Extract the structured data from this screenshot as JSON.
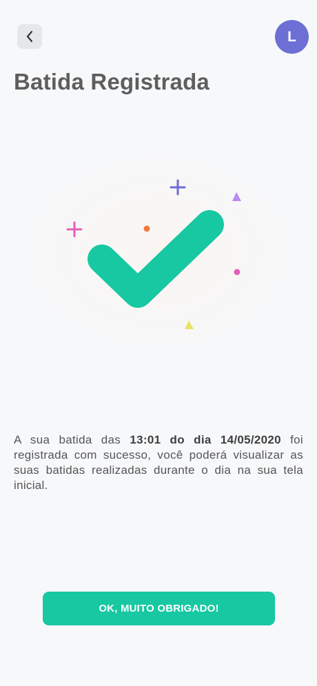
{
  "header": {
    "back_icon": "chevron-left-icon",
    "avatar_initial": "L",
    "avatar_color": "#6d6fd5"
  },
  "page": {
    "title": "Batida Registrada"
  },
  "illustration": {
    "icon": "checkmark-icon",
    "check_color": "#17c8a2",
    "confetti_colors": [
      "#6b6bd6",
      "#e85db7",
      "#ef7a3b",
      "#b98bf0",
      "#e85db7",
      "#e6e36b"
    ]
  },
  "message": {
    "part1": "A sua batida das ",
    "time_bold": "13:01 do dia 14/05/2020",
    "part2": " foi registrada com sucesso, você poderá visualizar as suas batidas realizadas durante o dia na sua tela inicial."
  },
  "actions": {
    "ok_label": "OK, MUITO OBRIGADO!",
    "ok_color": "#17c8a2"
  }
}
